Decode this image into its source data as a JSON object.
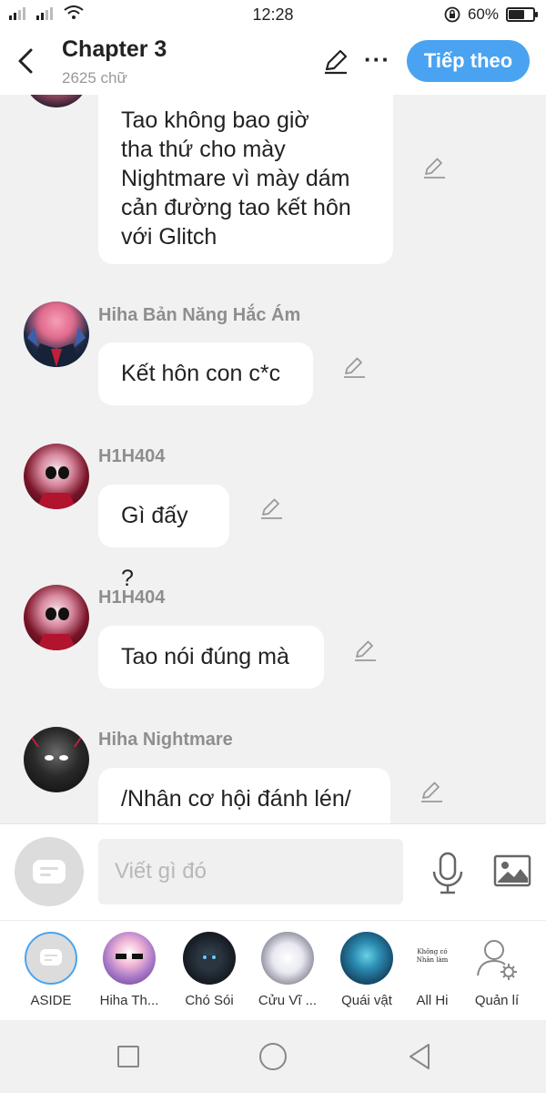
{
  "status": {
    "time": "12:28",
    "battery": "60%",
    "battery_level": 0.6
  },
  "header": {
    "title": "Chapter 3",
    "subtitle": "2625 chữ",
    "next_label": "Tiếp theo"
  },
  "messages": [
    {
      "sender": "",
      "text": "Tao không bao giờ\ntha thứ cho mày\nNightmare vì mày dám\ncản đường tao kết hôn\nvới Glitch"
    },
    {
      "sender": "Hiha Bản Năng Hắc Ám",
      "text": "Kết hôn con c*c"
    },
    {
      "sender": "H1H404",
      "text": "Gì đấy ?"
    },
    {
      "sender": "H1H404",
      "text": "Tao nói đúng mà"
    },
    {
      "sender": "Hiha Nightmare",
      "text": "/Nhân cơ hội đánh lén/"
    }
  ],
  "input": {
    "placeholder": "Viết gì đó"
  },
  "characters": [
    {
      "label": "ASIDE"
    },
    {
      "label": "Hiha Th..."
    },
    {
      "label": "Chó Sói"
    },
    {
      "label": "Cửu Vĩ ..."
    },
    {
      "label": "Quái vật"
    },
    {
      "label": "All Hi",
      "avatar_text": "Không có\nNhân làm"
    },
    {
      "label": "Quản lí"
    }
  ],
  "icons": {
    "back": "chevron-left-icon",
    "edit": "pencil-icon",
    "more": "more-dots-icon",
    "mic": "microphone-icon",
    "image": "image-icon",
    "manage": "user-settings-icon"
  },
  "colors": {
    "accent": "#4aa3f0",
    "background": "#f1f1f1",
    "bubble": "#ffffff",
    "sender": "#8e8e8e"
  }
}
